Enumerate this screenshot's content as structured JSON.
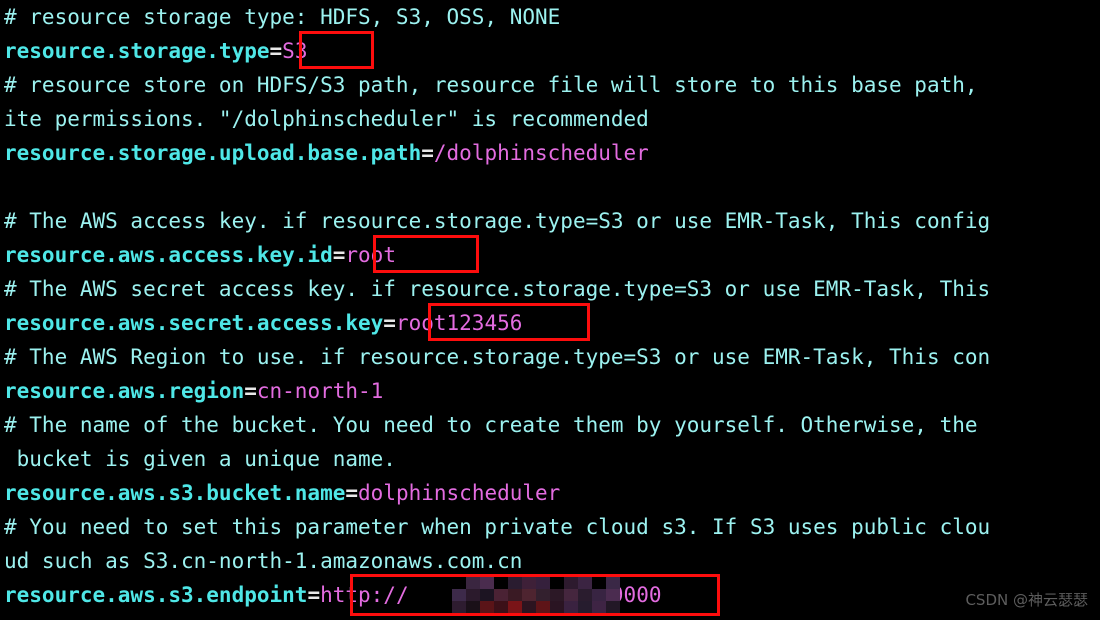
{
  "terminal": {
    "background": "#000000",
    "comment_color": "#9cf2f0",
    "key_color": "#4fe7e7",
    "value_color": "#e36ce0",
    "equals_color": "#e8e8e8",
    "highlight_color": "#fd0d0d",
    "font_size_px": 21,
    "line_height_px": 34
  },
  "lines": [
    {
      "type": "comment",
      "text": "# resource storage type: HDFS, S3, OSS, NONE"
    },
    {
      "type": "setting",
      "key": "resource.storage.type",
      "eq": "=",
      "value": "S3",
      "highlighted": true
    },
    {
      "type": "comment",
      "text": "# resource store on HDFS/S3 path, resource file will store to this base path,"
    },
    {
      "type": "comment",
      "text": "ite permissions. \"/dolphinscheduler\" is recommended"
    },
    {
      "type": "setting",
      "key": "resource.storage.upload.base.path",
      "eq": "=",
      "value": "/dolphinscheduler",
      "highlighted": false
    },
    {
      "type": "blank",
      "text": ""
    },
    {
      "type": "comment",
      "text": "# The AWS access key. if resource.storage.type=S3 or use EMR-Task, This config"
    },
    {
      "type": "setting",
      "key": "resource.aws.access.key.id",
      "eq": "=",
      "value": "root",
      "highlighted": true
    },
    {
      "type": "comment",
      "text": "# The AWS secret access key. if resource.storage.type=S3 or use EMR-Task, This"
    },
    {
      "type": "setting",
      "key": "resource.aws.secret.access.key",
      "eq": "=",
      "value": "root123456",
      "highlighted": true
    },
    {
      "type": "comment",
      "text": "# The AWS Region to use. if resource.storage.type=S3 or use EMR-Task, This con"
    },
    {
      "type": "setting",
      "key": "resource.aws.region",
      "eq": "=",
      "value": "cn-north-1",
      "highlighted": false
    },
    {
      "type": "comment",
      "text": "# The name of the bucket. You need to create them by yourself. Otherwise, the"
    },
    {
      "type": "comment",
      "text": " bucket is given a unique name."
    },
    {
      "type": "setting",
      "key": "resource.aws.s3.bucket.name",
      "eq": "=",
      "value": "dolphinscheduler",
      "highlighted": false
    },
    {
      "type": "comment",
      "text": "# You need to set this parameter when private cloud s3. If S3 uses public clou"
    },
    {
      "type": "comment",
      "text": "ud such as S3.cn-north-1.amazonaws.com.cn"
    },
    {
      "type": "setting",
      "key": "resource.aws.s3.endpoint",
      "eq": "=",
      "value_prefix": "http://",
      "value_redacted": true,
      "value_suffix": "17:9000",
      "highlighted": true
    }
  ],
  "watermark": {
    "text": "CSDN @神云瑟瑟",
    "color": "#6e6e6e"
  },
  "redaction": {
    "note": "mosaic",
    "tiles": [
      "#000000",
      "#3a2640",
      "#4a2c4e",
      "#000000",
      "#2a1c30",
      "#3e2038",
      "#35203c",
      "#000000",
      "#2d1a2e",
      "#3b2442",
      "#000000",
      "#3a2846",
      "#3d2a4a",
      "#2b1a2c",
      "#1c1422",
      "#4a2234",
      "#3a1a24",
      "#4e2430",
      "#33202e",
      "#2c1826",
      "#45263e",
      "#2a1c2e",
      "#382442",
      "#4b2c50",
      "#2e1c30",
      "#1a1018",
      "#5a1418",
      "#3c1018",
      "#7a1418",
      "#2c1420",
      "#5e1418",
      "#2a1422",
      "#3a2240",
      "#261c2e",
      "#3e2444",
      "#221826"
    ]
  }
}
